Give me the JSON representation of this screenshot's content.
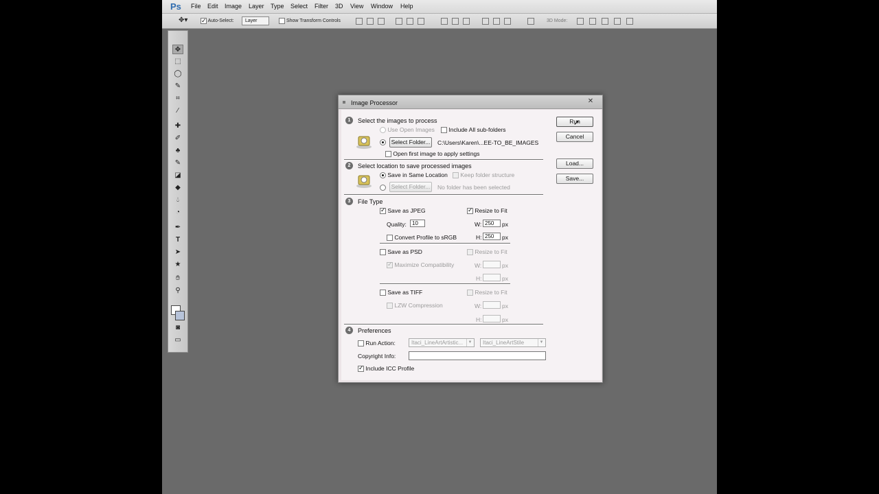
{
  "menubar": {
    "logo": "Ps",
    "items": [
      "File",
      "Edit",
      "Image",
      "Layer",
      "Type",
      "Select",
      "Filter",
      "3D",
      "View",
      "Window",
      "Help"
    ]
  },
  "options_bar": {
    "auto_select_label": "Auto-Select:",
    "auto_select_value": "Layer",
    "show_transform_label": "Show Transform Controls",
    "mode_3d_label": "3D Mode:"
  },
  "dialog": {
    "title": "Image Processor",
    "close_glyph": "✕",
    "buttons": {
      "run": "Run",
      "cancel": "Cancel",
      "load": "Load...",
      "save": "Save..."
    },
    "section1": {
      "number": "1",
      "title": "Select the images to process",
      "use_open_images": "Use Open Images",
      "include_subfolders": "Include All sub-folders",
      "select_folder_button": "Select Folder...",
      "folder_path": "C:\\Users\\Karen\\...EE-TO_BE_IMAGES",
      "open_first_image": "Open first image to apply settings"
    },
    "section2": {
      "number": "2",
      "title": "Select location to save processed images",
      "save_same_location": "Save in Same Location",
      "keep_folder_structure": "Keep folder structure",
      "select_folder_button": "Select Folder...",
      "no_folder": "No folder has been selected"
    },
    "section3": {
      "number": "3",
      "title": "File Type",
      "jpeg": {
        "save_as": "Save as JPEG",
        "resize": "Resize to Fit",
        "quality_label": "Quality:",
        "quality_value": "10",
        "w_label": "W:",
        "w_value": "250",
        "h_label": "H:",
        "h_value": "250",
        "unit": "px",
        "convert_profile": "Convert Profile to sRGB"
      },
      "psd": {
        "save_as": "Save as PSD",
        "resize": "Resize to Fit",
        "maximize": "Maximize Compatibility",
        "w_label": "W:",
        "h_label": "H:",
        "unit": "px"
      },
      "tiff": {
        "save_as": "Save as TIFF",
        "resize": "Resize to Fit",
        "lzw": "LZW Compression",
        "w_label": "W:",
        "h_label": "H:",
        "unit": "px"
      }
    },
    "section4": {
      "number": "4",
      "title": "Preferences",
      "run_action": "Run Action:",
      "action_set": "Itaci_LineArtArtistic...",
      "action_name": "Itaci_LineArtStile",
      "copyright_label": "Copyright Info:",
      "copyright_value": "",
      "include_icc": "Include ICC Profile"
    }
  }
}
